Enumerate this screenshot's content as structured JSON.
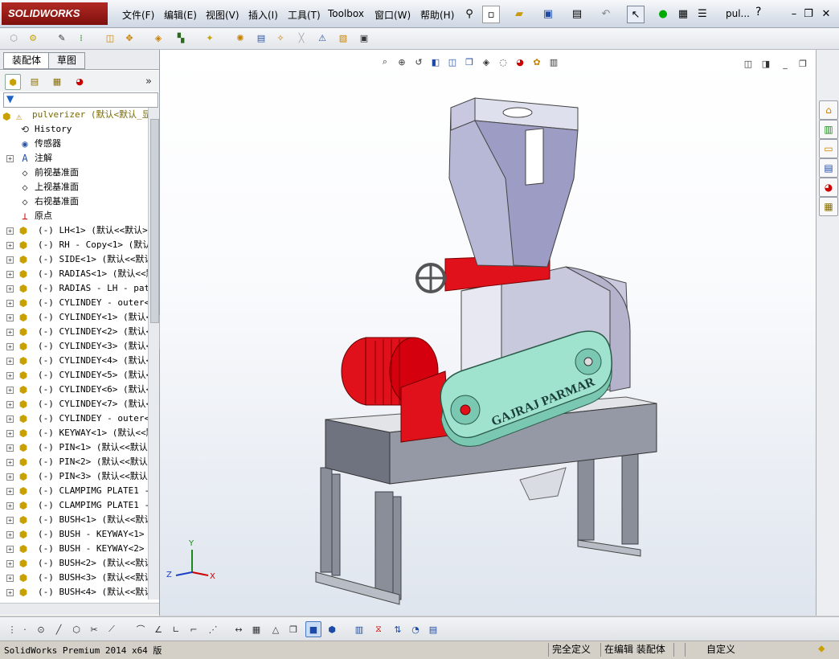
{
  "app": {
    "logo_text": "SOLIDWORKS",
    "doc_title": "pul...",
    "help_label": "?"
  },
  "menu": [
    "文件(F)",
    "编辑(E)",
    "视图(V)",
    "插入(I)",
    "工具(T)",
    "Toolbox",
    "窗口(W)",
    "帮助(H)"
  ],
  "panel": {
    "tabs": [
      "装配体",
      "草图"
    ],
    "tree_root": "pulverizer  (默认<默认_显",
    "tree": [
      {
        "icon": "history",
        "label": "History",
        "expand": false
      },
      {
        "icon": "sensor",
        "label": "传感器",
        "expand": false
      },
      {
        "icon": "annotation",
        "label": "注解",
        "expand": true
      },
      {
        "icon": "plane",
        "label": "前视基准面",
        "expand": false
      },
      {
        "icon": "plane",
        "label": "上视基准面",
        "expand": false
      },
      {
        "icon": "plane",
        "label": "右视基准面",
        "expand": false
      },
      {
        "icon": "origin",
        "label": "原点",
        "expand": false
      },
      {
        "icon": "part",
        "label": "(-) LH<1> (默认<<默认>_",
        "expand": true
      },
      {
        "icon": "part",
        "label": "(-) RH - Copy<1> (默认<",
        "expand": true
      },
      {
        "icon": "part",
        "label": "(-) SIDE<1> (默认<<默认",
        "expand": true
      },
      {
        "icon": "part",
        "label": "(-) RADIAS<1> (默认<<默",
        "expand": true
      },
      {
        "icon": "part",
        "label": "(-) RADIAS - LH - patti",
        "expand": true
      },
      {
        "icon": "part",
        "label": "(-) CYLINDEY - outer<1>",
        "expand": true
      },
      {
        "icon": "part",
        "label": "(-) CYLINDEY<1> (默认<<",
        "expand": true
      },
      {
        "icon": "part",
        "label": "(-) CYLINDEY<2> (默认<<",
        "expand": true
      },
      {
        "icon": "part",
        "label": "(-) CYLINDEY<3> (默认<<",
        "expand": true
      },
      {
        "icon": "part",
        "label": "(-) CYLINDEY<4> (默认<<",
        "expand": true
      },
      {
        "icon": "part",
        "label": "(-) CYLINDEY<5> (默认<<",
        "expand": true
      },
      {
        "icon": "part",
        "label": "(-) CYLINDEY<6> (默认<<",
        "expand": true
      },
      {
        "icon": "part",
        "label": "(-) CYLINDEY<7> (默认<<",
        "expand": true
      },
      {
        "icon": "part",
        "label": "(-) CYLINDEY - outer<2>",
        "expand": true
      },
      {
        "icon": "part",
        "label": "(-) KEYWAY<1> (默认<<默",
        "expand": true
      },
      {
        "icon": "part",
        "label": "(-) PIN<1> (默认<<默认>",
        "expand": true
      },
      {
        "icon": "part",
        "label": "(-) PIN<2> (默认<<默认>",
        "expand": true
      },
      {
        "icon": "part",
        "label": "(-) PIN<3> (默认<<默认>",
        "expand": true
      },
      {
        "icon": "part",
        "label": "(-) CLAMPIMG PLATE1 - 4",
        "expand": true
      },
      {
        "icon": "part",
        "label": "(-) CLAMPIMG PLATE1 - 4",
        "expand": true
      },
      {
        "icon": "part",
        "label": "(-) BUSH<1> (默认<<默认",
        "expand": true
      },
      {
        "icon": "part",
        "label": "(-) BUSH - KEYWAY<1> (默",
        "expand": true
      },
      {
        "icon": "part",
        "label": "(-) BUSH - KEYWAY<2> (默",
        "expand": true
      },
      {
        "icon": "part",
        "label": "(-) BUSH<2> (默认<<默认",
        "expand": true
      },
      {
        "icon": "part",
        "label": "(-) BUSH<3> (默认<<默认",
        "expand": true
      },
      {
        "icon": "part",
        "label": "(-) BUSH<4> (默认<<默认",
        "expand": true
      }
    ]
  },
  "model": {
    "belt_text": "GAJRAJ PARMAR"
  },
  "triad": {
    "x": "X",
    "y": "Y",
    "z": "Z"
  },
  "status": {
    "product": "SolidWorks Premium 2014 x64 版",
    "state1": "完全定义",
    "state2": "在编辑 装配体",
    "units": "自定义"
  },
  "colors": {
    "brand_red": "#b22a24",
    "motor_red": "#e0111a",
    "guard_mint": "#9fe3cf",
    "frame_gray": "#8a8e99",
    "hopper_lilac": "#b7b7d6"
  }
}
